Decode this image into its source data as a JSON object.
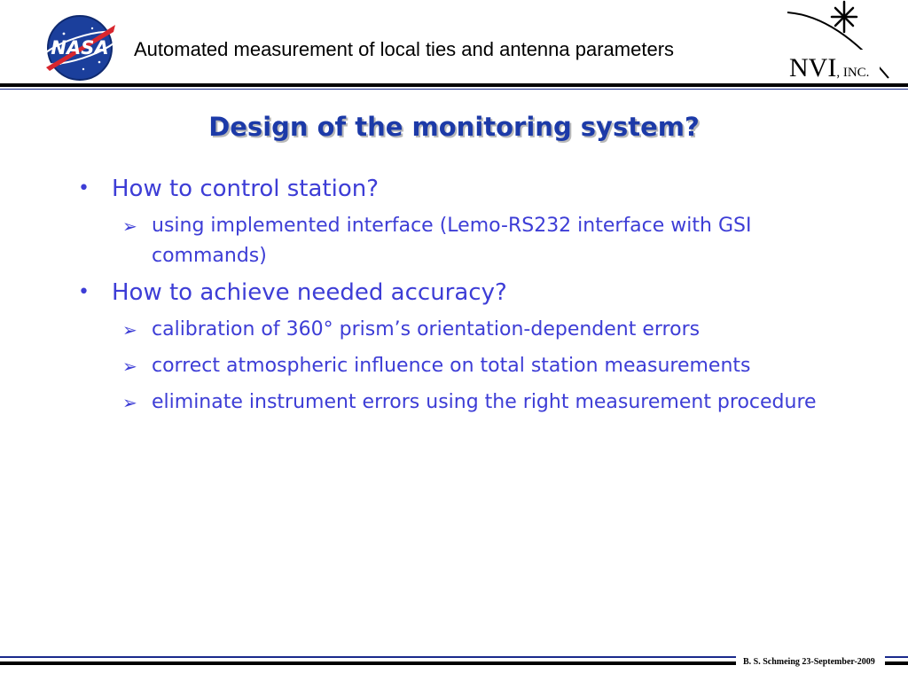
{
  "header": {
    "title": "Automated measurement of local ties and antenna parameters",
    "nasa_logo_icon": "nasa-meatball-logo",
    "nvi_logo": {
      "icon": "nvi-star-swoosh-logo",
      "text": "NVI",
      "suffix": ", INC."
    }
  },
  "slide": {
    "title": "Design of the monitoring system?",
    "bullets": [
      {
        "text": "How to control station?",
        "sub": [
          "using implemented interface (Lemo-RS232 interface with GSI commands)"
        ]
      },
      {
        "text": "How to achieve needed accuracy?",
        "sub": [
          "calibration of 360° prism’s orientation-dependent errors",
          "correct atmospheric influence on total station measurements",
          "eliminate instrument errors using the right measurement procedure"
        ]
      }
    ]
  },
  "footer": {
    "text": "B. S. Schmeing 23-September-2009"
  },
  "colors": {
    "text_blue": "#3d3dd6",
    "title_blue": "#1c3aa8",
    "rule_blue": "#1a2a8c"
  }
}
